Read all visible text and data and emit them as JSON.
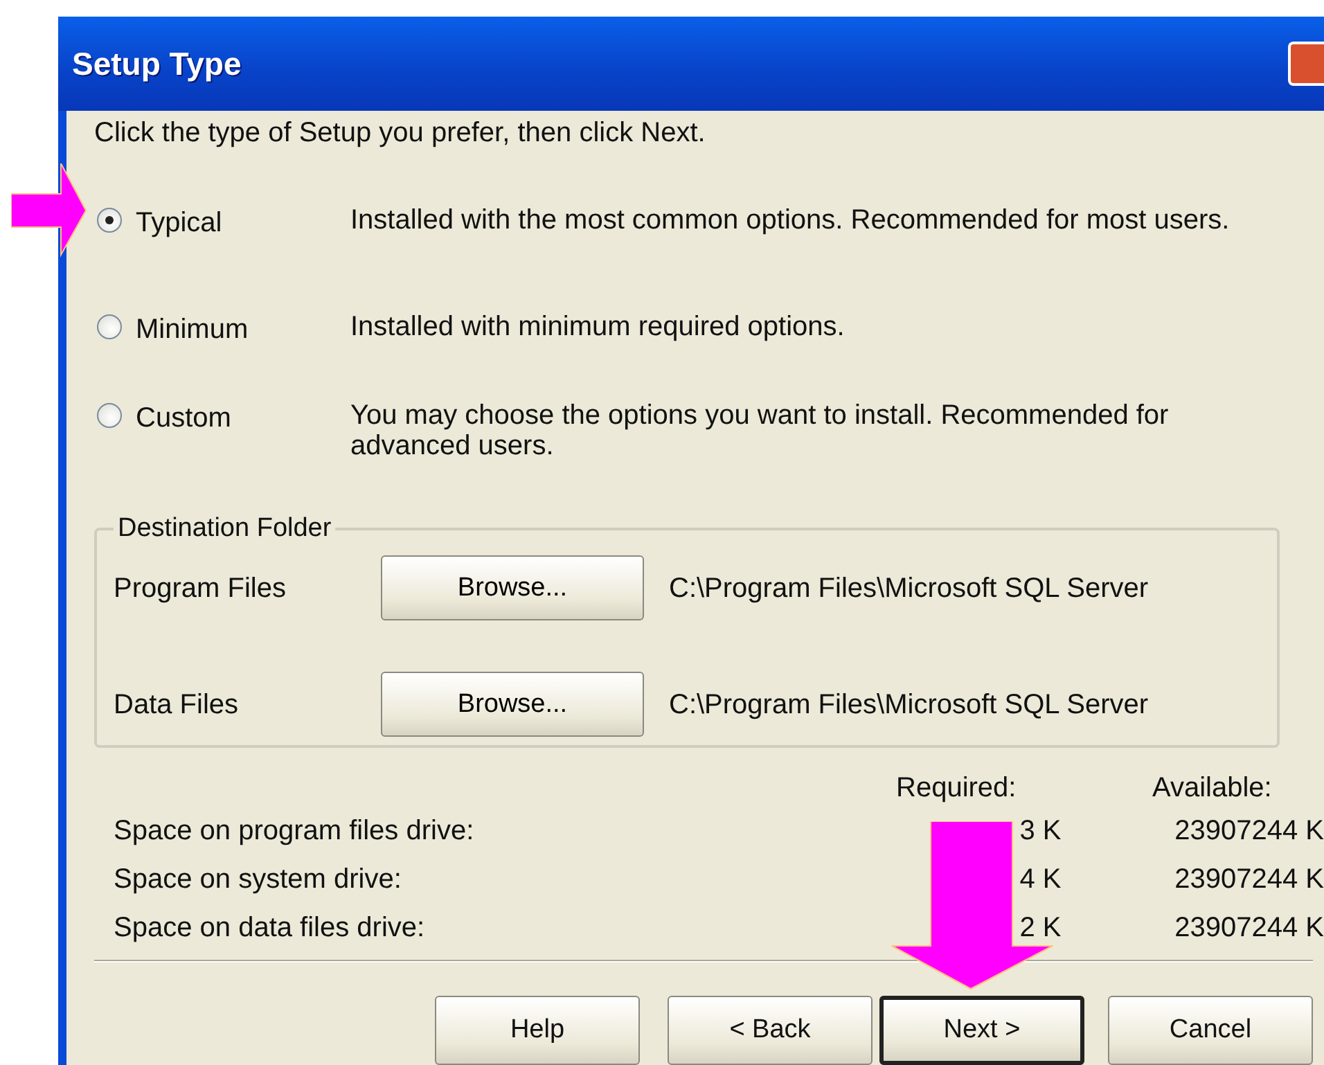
{
  "window": {
    "title": "Setup Type"
  },
  "instruction": "Click the type of Setup you prefer, then click Next.",
  "setup_types": [
    {
      "label": "Typical",
      "description": "Installed with the most common options. Recommended for most users.",
      "selected": true
    },
    {
      "label": "Minimum",
      "description": "Installed with minimum required options.",
      "selected": false
    },
    {
      "label": "Custom",
      "description": "You may choose the options you want to install. Recommended for advanced users.",
      "selected": false
    }
  ],
  "destination_folder": {
    "title": "Destination Folder",
    "rows": [
      {
        "label": "Program Files",
        "button": "Browse...",
        "path": "C:\\Program Files\\Microsoft SQL Server"
      },
      {
        "label": "Data Files",
        "button": "Browse...",
        "path": "C:\\Program Files\\Microsoft SQL Server"
      }
    ]
  },
  "space": {
    "columns": [
      "Required:",
      "Available:"
    ],
    "rows": [
      {
        "label": "Space on program files drive:",
        "required": "3 K",
        "available": "23907244 K"
      },
      {
        "label": "Space on system drive:",
        "required": "4 K",
        "available": "23907244 K"
      },
      {
        "label": "Space on data files drive:",
        "required": "2 K",
        "available": "23907244 K"
      }
    ]
  },
  "buttons": [
    {
      "label": "Help",
      "default": false
    },
    {
      "label": "< Back",
      "default": false
    },
    {
      "label": "Next >",
      "default": true
    },
    {
      "label": "Cancel",
      "default": false
    }
  ]
}
